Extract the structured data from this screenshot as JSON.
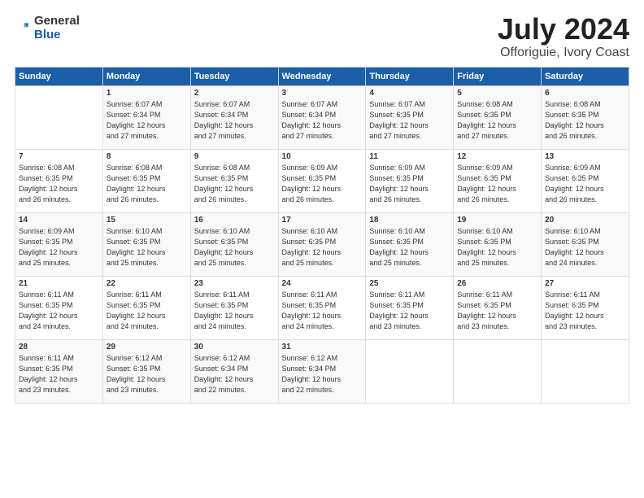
{
  "logo": {
    "general": "General",
    "blue": "Blue"
  },
  "title": "July 2024",
  "location": "Offoriguie, Ivory Coast",
  "days_of_week": [
    "Sunday",
    "Monday",
    "Tuesday",
    "Wednesday",
    "Thursday",
    "Friday",
    "Saturday"
  ],
  "weeks": [
    [
      {
        "day": "",
        "info": ""
      },
      {
        "day": "1",
        "info": "Sunrise: 6:07 AM\nSunset: 6:34 PM\nDaylight: 12 hours\nand 27 minutes."
      },
      {
        "day": "2",
        "info": "Sunrise: 6:07 AM\nSunset: 6:34 PM\nDaylight: 12 hours\nand 27 minutes."
      },
      {
        "day": "3",
        "info": "Sunrise: 6:07 AM\nSunset: 6:34 PM\nDaylight: 12 hours\nand 27 minutes."
      },
      {
        "day": "4",
        "info": "Sunrise: 6:07 AM\nSunset: 6:35 PM\nDaylight: 12 hours\nand 27 minutes."
      },
      {
        "day": "5",
        "info": "Sunrise: 6:08 AM\nSunset: 6:35 PM\nDaylight: 12 hours\nand 27 minutes."
      },
      {
        "day": "6",
        "info": "Sunrise: 6:08 AM\nSunset: 6:35 PM\nDaylight: 12 hours\nand 26 minutes."
      }
    ],
    [
      {
        "day": "7",
        "info": "Sunrise: 6:08 AM\nSunset: 6:35 PM\nDaylight: 12 hours\nand 26 minutes."
      },
      {
        "day": "8",
        "info": "Sunrise: 6:08 AM\nSunset: 6:35 PM\nDaylight: 12 hours\nand 26 minutes."
      },
      {
        "day": "9",
        "info": "Sunrise: 6:08 AM\nSunset: 6:35 PM\nDaylight: 12 hours\nand 26 minutes."
      },
      {
        "day": "10",
        "info": "Sunrise: 6:09 AM\nSunset: 6:35 PM\nDaylight: 12 hours\nand 26 minutes."
      },
      {
        "day": "11",
        "info": "Sunrise: 6:09 AM\nSunset: 6:35 PM\nDaylight: 12 hours\nand 26 minutes."
      },
      {
        "day": "12",
        "info": "Sunrise: 6:09 AM\nSunset: 6:35 PM\nDaylight: 12 hours\nand 26 minutes."
      },
      {
        "day": "13",
        "info": "Sunrise: 6:09 AM\nSunset: 6:35 PM\nDaylight: 12 hours\nand 26 minutes."
      }
    ],
    [
      {
        "day": "14",
        "info": "Sunrise: 6:09 AM\nSunset: 6:35 PM\nDaylight: 12 hours\nand 25 minutes."
      },
      {
        "day": "15",
        "info": "Sunrise: 6:10 AM\nSunset: 6:35 PM\nDaylight: 12 hours\nand 25 minutes."
      },
      {
        "day": "16",
        "info": "Sunrise: 6:10 AM\nSunset: 6:35 PM\nDaylight: 12 hours\nand 25 minutes."
      },
      {
        "day": "17",
        "info": "Sunrise: 6:10 AM\nSunset: 6:35 PM\nDaylight: 12 hours\nand 25 minutes."
      },
      {
        "day": "18",
        "info": "Sunrise: 6:10 AM\nSunset: 6:35 PM\nDaylight: 12 hours\nand 25 minutes."
      },
      {
        "day": "19",
        "info": "Sunrise: 6:10 AM\nSunset: 6:35 PM\nDaylight: 12 hours\nand 25 minutes."
      },
      {
        "day": "20",
        "info": "Sunrise: 6:10 AM\nSunset: 6:35 PM\nDaylight: 12 hours\nand 24 minutes."
      }
    ],
    [
      {
        "day": "21",
        "info": "Sunrise: 6:11 AM\nSunset: 6:35 PM\nDaylight: 12 hours\nand 24 minutes."
      },
      {
        "day": "22",
        "info": "Sunrise: 6:11 AM\nSunset: 6:35 PM\nDaylight: 12 hours\nand 24 minutes."
      },
      {
        "day": "23",
        "info": "Sunrise: 6:11 AM\nSunset: 6:35 PM\nDaylight: 12 hours\nand 24 minutes."
      },
      {
        "day": "24",
        "info": "Sunrise: 6:11 AM\nSunset: 6:35 PM\nDaylight: 12 hours\nand 24 minutes."
      },
      {
        "day": "25",
        "info": "Sunrise: 6:11 AM\nSunset: 6:35 PM\nDaylight: 12 hours\nand 23 minutes."
      },
      {
        "day": "26",
        "info": "Sunrise: 6:11 AM\nSunset: 6:35 PM\nDaylight: 12 hours\nand 23 minutes."
      },
      {
        "day": "27",
        "info": "Sunrise: 6:11 AM\nSunset: 6:35 PM\nDaylight: 12 hours\nand 23 minutes."
      }
    ],
    [
      {
        "day": "28",
        "info": "Sunrise: 6:11 AM\nSunset: 6:35 PM\nDaylight: 12 hours\nand 23 minutes."
      },
      {
        "day": "29",
        "info": "Sunrise: 6:12 AM\nSunset: 6:35 PM\nDaylight: 12 hours\nand 23 minutes."
      },
      {
        "day": "30",
        "info": "Sunrise: 6:12 AM\nSunset: 6:34 PM\nDaylight: 12 hours\nand 22 minutes."
      },
      {
        "day": "31",
        "info": "Sunrise: 6:12 AM\nSunset: 6:34 PM\nDaylight: 12 hours\nand 22 minutes."
      },
      {
        "day": "",
        "info": ""
      },
      {
        "day": "",
        "info": ""
      },
      {
        "day": "",
        "info": ""
      }
    ]
  ]
}
